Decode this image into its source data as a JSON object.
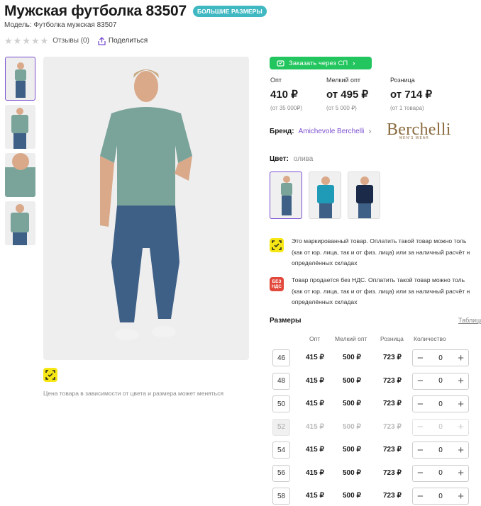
{
  "product": {
    "title": "Мужская футболка 83507",
    "badge": "БОЛЬШИЕ РАЗМЕРЫ",
    "model": "Модель: Футболка мужская 83507",
    "reviews": "Отзывы (0)",
    "share": "Поделиться",
    "rating_stars": 0
  },
  "order_sp": {
    "label": "Заказать через СП"
  },
  "prices": [
    {
      "label": "Опт",
      "value": "410 ₽",
      "sub": "(от 35 000₽)"
    },
    {
      "label": "Мелкий опт",
      "value": "от 495 ₽",
      "sub": "(от 5 000 ₽)"
    },
    {
      "label": "Розница",
      "value": "от 714 ₽",
      "sub": "(от 1 товара)"
    }
  ],
  "brand": {
    "label": "Бренд:",
    "name": "Amichevole Berchelli",
    "logo": "Berchelli",
    "logo_sub": "MEN'S WEAR"
  },
  "color": {
    "label": "Цвет:",
    "value": "олива"
  },
  "notices": [
    {
      "icon": "marking-icon",
      "lines": [
        "Это маркированный товар. Оплатить такой товар можно толь",
        "(как от юр. лица, так и от физ. лица) или за наличный расчёт н",
        "определённых складах"
      ]
    },
    {
      "icon": "no-vat-icon",
      "icon_text": [
        "БЕЗ",
        "НДС"
      ],
      "lines": [
        "Товар продается без НДС. Оплатить такой товар можно толь",
        "(как от юр. лица, так и от физ. лица) или за наличный расчёт н",
        "определённых складах"
      ]
    }
  ],
  "price_note": "Цена товара в зависимости от цвета и размера может меняться",
  "sizes": {
    "title": "Размеры",
    "table_link": "Таблица",
    "columns": [
      "Опт",
      "Мелкий опт",
      "Розница",
      "Количество"
    ],
    "rows": [
      {
        "size": "46",
        "opt": "415 ₽",
        "small": "500 ₽",
        "retail": "723 ₽",
        "qty": "0"
      },
      {
        "size": "48",
        "opt": "415 ₽",
        "small": "500 ₽",
        "retail": "723 ₽",
        "qty": "0"
      },
      {
        "size": "50",
        "opt": "415 ₽",
        "small": "500 ₽",
        "retail": "723 ₽",
        "qty": "0"
      },
      {
        "size": "52",
        "opt": "415 ₽",
        "small": "500 ₽",
        "retail": "723 ₽",
        "qty": "0",
        "disabled": true
      },
      {
        "size": "54",
        "opt": "415 ₽",
        "small": "500 ₽",
        "retail": "723 ₽",
        "qty": "0"
      },
      {
        "size": "56",
        "opt": "415 ₽",
        "small": "500 ₽",
        "retail": "723 ₽",
        "qty": "0"
      },
      {
        "size": "58",
        "opt": "415 ₽",
        "small": "500 ₽",
        "retail": "723 ₽",
        "qty": "0"
      }
    ]
  },
  "colors": {
    "accent": "#7a4fd0",
    "sp_green": "#22c55e",
    "badge": "#3fb8c2",
    "mark_yellow": "#f5e614",
    "nds_red": "#e2473b"
  }
}
